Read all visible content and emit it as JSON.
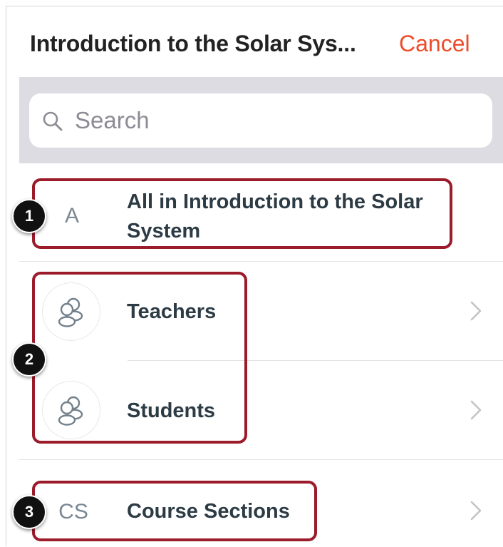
{
  "header": {
    "title": "Introduction to the Solar Sys...",
    "cancel_label": "Cancel"
  },
  "search": {
    "placeholder": "Search",
    "icon": "search-icon"
  },
  "rows": [
    {
      "letter": "A",
      "label_line1": "All in Introduction to the Solar",
      "label_line2": "System",
      "icon": "letter-avatar",
      "has_chevron": false
    },
    {
      "label": "Teachers",
      "icon": "people-icon",
      "has_chevron": true
    },
    {
      "label": "Students",
      "icon": "people-icon",
      "has_chevron": true
    },
    {
      "letter": "CS",
      "label": "Course Sections",
      "icon": "letter-avatar",
      "has_chevron": true
    }
  ],
  "annotations": [
    "1",
    "2",
    "3"
  ],
  "colors": {
    "accent": "#ec4d2a",
    "highlight_border": "#9b1b2a",
    "search_band": "#dcdce2",
    "text_dark": "#2d3b45"
  }
}
